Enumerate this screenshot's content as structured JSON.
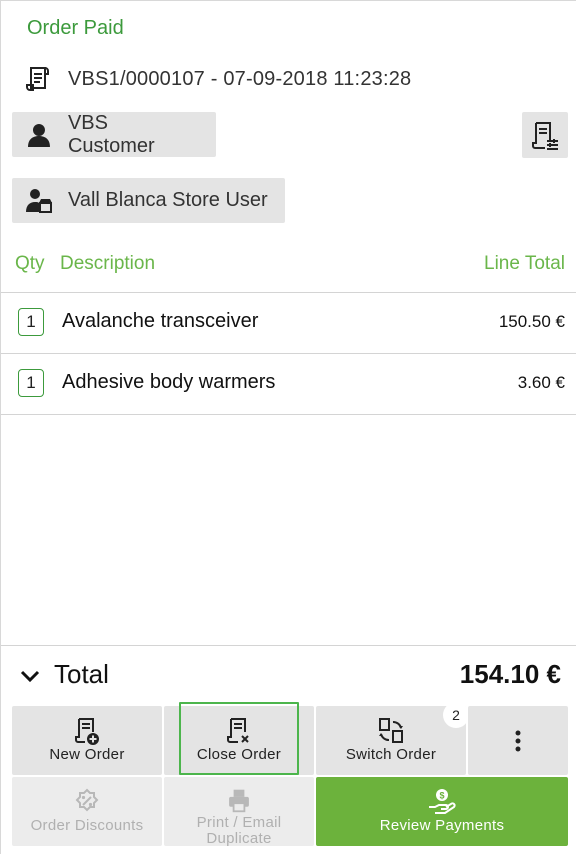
{
  "order": {
    "status": "Order Paid",
    "document": "VBS1/0000107 - 07-09-2018 11:23:28",
    "customer": "VBS Customer",
    "user": "Vall Blanca Store User"
  },
  "lines_header": {
    "qty": "Qty",
    "description": "Description",
    "line_total": "Line Total"
  },
  "lines": [
    {
      "qty": "1",
      "description": "Avalanche transceiver",
      "amount": "150.50 €"
    },
    {
      "qty": "1",
      "description": "Adhesive body warmers",
      "amount": "3.60 €"
    }
  ],
  "total": {
    "label": "Total",
    "value": "154.10 €"
  },
  "buttons": {
    "new_order": "New Order",
    "close_order": "Close Order",
    "switch_order": "Switch Order",
    "switch_badge": "2",
    "order_discounts": "Order Discounts",
    "print_email_line1": "Print / Email",
    "print_email_line2": "Duplicate",
    "review_payments": "Review Payments"
  },
  "colors": {
    "accent_green": "#6cb23c",
    "status_green": "#3c9a3c",
    "header_green": "#6ab64a",
    "button_gray": "#e4e4e4"
  },
  "icons": {
    "document": "receipt-icon",
    "customer": "person-icon",
    "user": "store-user-icon",
    "customer_menu": "receipt-settings-icon",
    "collapse": "chevron-down-icon",
    "new_order": "receipt-add-icon",
    "close_order": "receipt-close-icon",
    "switch_order": "receipt-switch-icon",
    "more": "more-vertical-icon",
    "discounts": "discount-icon",
    "print": "printer-icon",
    "review": "payment-hand-icon"
  }
}
